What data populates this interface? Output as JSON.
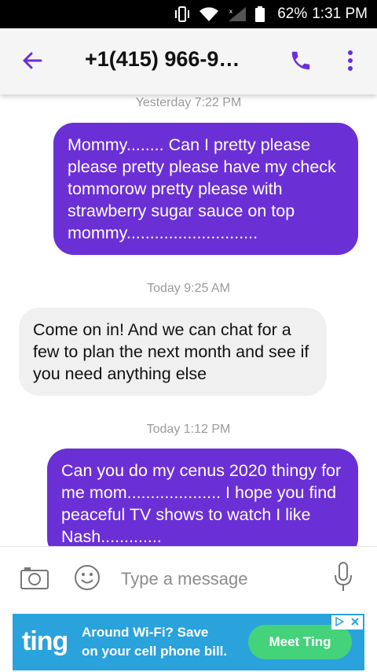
{
  "status_bar": {
    "battery": "62%",
    "time": "1:31 PM"
  },
  "header": {
    "title": "+1(415) 966-9…"
  },
  "thread": {
    "messages": [
      {
        "timestamp": "Yesterday 7:22 PM",
        "direction": "outgoing",
        "text": "Mommy........ Can I pretty please please pretty please have my check tommorow pretty please with strawberry sugar sauce on top mommy............................"
      },
      {
        "timestamp": "Today 9:25 AM",
        "direction": "incoming",
        "text": "Come on in! And we can chat for a few to plan the next month and see if you need anything else"
      },
      {
        "timestamp": "Today 1:12 PM",
        "direction": "outgoing",
        "text": "Can you do my cenus 2020 thingy for me mom.................... I hope you find peaceful TV shows to watch I like Nash............."
      }
    ]
  },
  "composer": {
    "placeholder": "Type a message"
  },
  "ad": {
    "logo": "ting",
    "line1": "Around Wi-Fi? Save",
    "line2": "on your cell phone bill.",
    "cta": "Meet Ting"
  },
  "colors": {
    "accent": "#6b2fd6",
    "incoming_bubble": "#f0f0f0",
    "ad_background": "#2aa2dc",
    "ad_button": "#44d27a"
  },
  "icons": [
    "vibrate-icon",
    "wifi-icon",
    "signal-icon",
    "battery-icon",
    "back-arrow-icon",
    "phone-icon",
    "more-vert-icon",
    "camera-icon",
    "emoji-icon",
    "mic-icon",
    "ad-choices-icon",
    "close-icon"
  ]
}
